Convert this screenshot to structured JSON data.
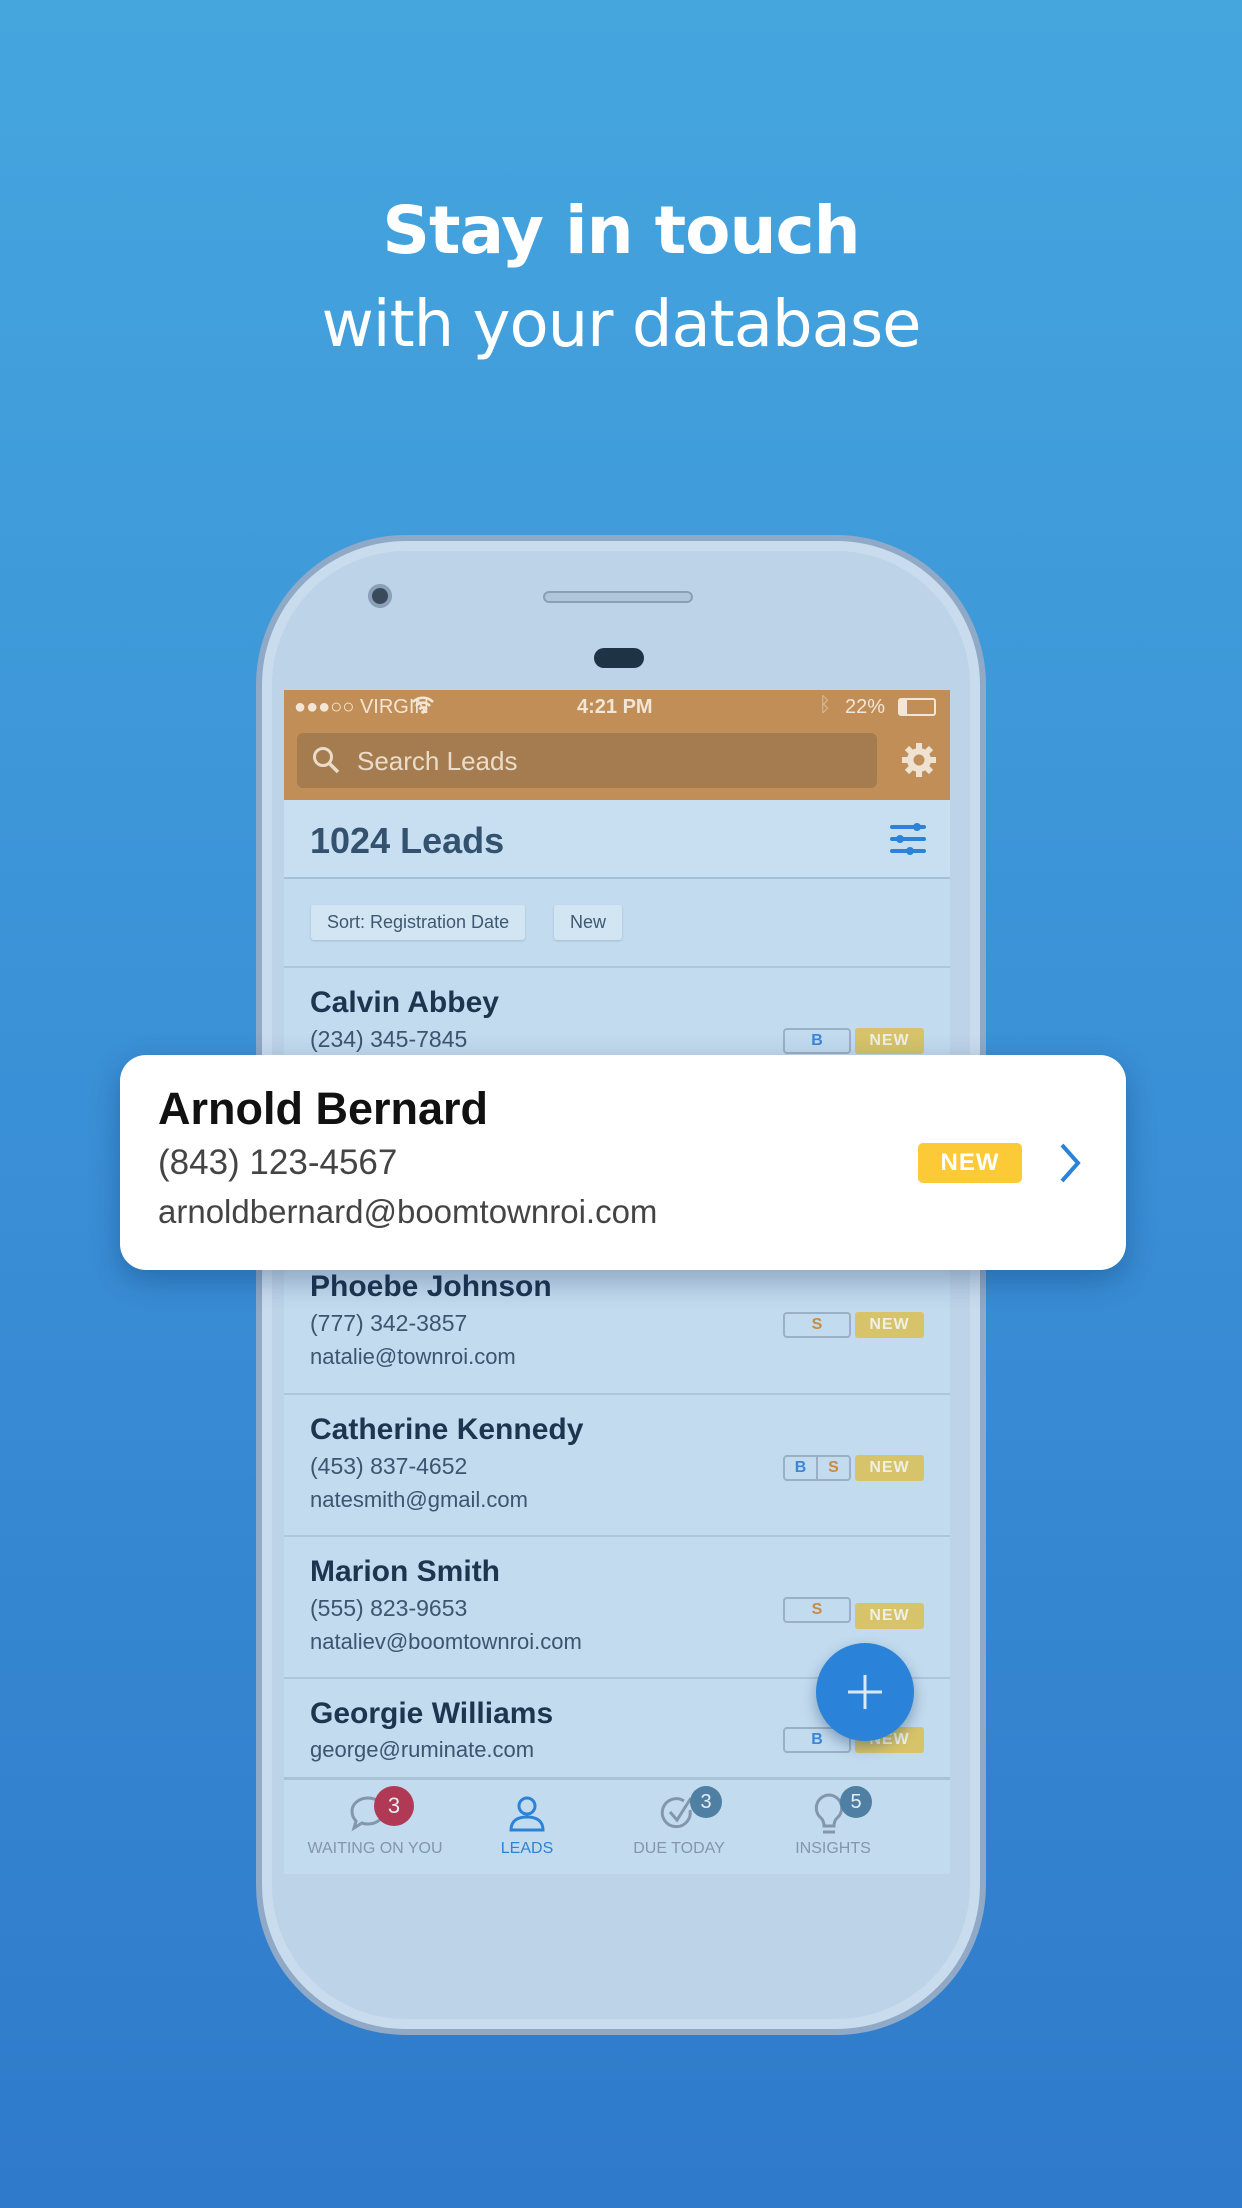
{
  "headline": {
    "title": "Stay in touch",
    "subtitle": "with your database"
  },
  "status_bar": {
    "carrier": "●●●○○ VIRGIN",
    "time": "4:21 PM",
    "battery": "22%",
    "battery_level": 0.22
  },
  "search": {
    "placeholder": "Search Leads"
  },
  "header": {
    "title": "1024 Leads"
  },
  "filters": {
    "sort_label": "Sort: Registration Date",
    "status_label": "New"
  },
  "leads": [
    {
      "name": "Calvin Abbey",
      "phone": "(234) 345-7845",
      "email": "",
      "tags": [
        "B"
      ],
      "status": "NEW"
    },
    {
      "name": "Phoebe Johnson",
      "phone": "(777) 342-3857",
      "email": "natalie@townroi.com",
      "tags": [
        "S"
      ],
      "status": "NEW"
    },
    {
      "name": "Catherine Kennedy",
      "phone": "(453) 837-4652",
      "email": "natesmith@gmail.com",
      "tags": [
        "B",
        "S"
      ],
      "status": "NEW"
    },
    {
      "name": "Marion Smith",
      "phone": "(555) 823-9653",
      "email": "nataliev@boomtownroi.com",
      "tags": [
        "S"
      ],
      "status": "NEW"
    },
    {
      "name": "Georgie Williams",
      "phone": "",
      "email": "george@ruminate.com",
      "tags": [
        "B"
      ],
      "status": "NEW"
    }
  ],
  "highlight_card": {
    "name": "Arnold Bernard",
    "phone": "(843) 123-4567",
    "email": "arnoldbernard@boomtownroi.com",
    "status": "NEW"
  },
  "tabs": [
    {
      "label": "WAITING ON YOU",
      "badge": "3",
      "icon": "chat-bubble-icon",
      "active": false
    },
    {
      "label": "LEADS",
      "badge": "",
      "icon": "person-icon",
      "active": true
    },
    {
      "label": "DUE TODAY",
      "badge": "3",
      "icon": "check-circle-icon",
      "active": false
    },
    {
      "label": "INSIGHTS",
      "badge": "5",
      "icon": "lightbulb-icon",
      "active": false
    }
  ],
  "colors": {
    "accent": "#2a83d8",
    "tag_b": "#3d86d6",
    "tag_s": "#c98a45",
    "new_badge": "#fcc937",
    "alert_badge": "#b03a55",
    "info_badge": "#4f7fa3"
  }
}
